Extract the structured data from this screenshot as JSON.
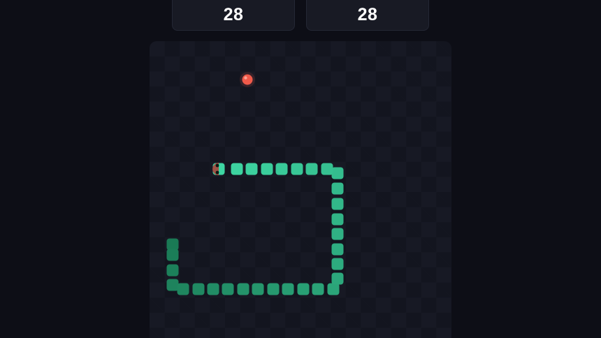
{
  "scores": {
    "left_value": "28",
    "right_value": "28"
  },
  "colors": {
    "background": "#0d0e16",
    "card": "#181a24",
    "board": "#171924",
    "snake_head": "#3ed6a3",
    "snake_tail": "#1a7a55",
    "food": "#f05a4a",
    "eye": "#0b1a14"
  },
  "snake": {
    "direction": "left",
    "length": 27
  }
}
